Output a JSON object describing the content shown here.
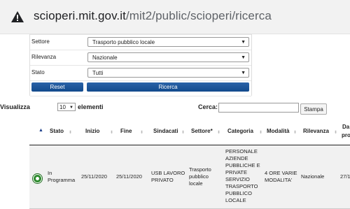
{
  "browser": {
    "url_host": "scioperi.mit.gov.it",
    "url_path": "/mit2/public/scioperi/ricerca"
  },
  "filters": [
    {
      "label": "Settore",
      "value": "Trasporto pubblico locale"
    },
    {
      "label": "Rilevanza",
      "value": "Nazionale"
    },
    {
      "label": "Stato",
      "value": "Tutti"
    }
  ],
  "buttons": {
    "reset": "Reset",
    "ricerca": "Ricerca"
  },
  "controls": {
    "visualizza": "Visualizza",
    "page_length": "10",
    "elementi": "elementi",
    "cerca": "Cerca:",
    "stampa": "Stampa"
  },
  "table": {
    "headers": [
      "Stato",
      "Inizio",
      "Fine",
      "Sindacati",
      "Settore*",
      "Categoria",
      "Modalità",
      "Rilevanza",
      "Da",
      "pro"
    ],
    "row": {
      "stato": [
        "In",
        "Programma"
      ],
      "inizio": "25/11/2020",
      "fine": "25/11/2020",
      "sindacati": [
        "USB LAVORO",
        "PRIVATO"
      ],
      "settore": [
        "Trasporto",
        "pubblico",
        "locale"
      ],
      "categoria": [
        "PERSONALE",
        "AZIENDE",
        "PUBBLICHE E",
        "PRIVATE",
        "SERVIZIO",
        "TRASPORTO",
        "PUBBLICO",
        "LOCALE"
      ],
      "modalita": [
        "4 ORE VARIE",
        "MODALITA'"
      ],
      "rilevanza": "Nazionale",
      "data": "27/1"
    }
  },
  "colors": {
    "button_blue": "#1a559b",
    "status_green": "#2e8b2e"
  }
}
